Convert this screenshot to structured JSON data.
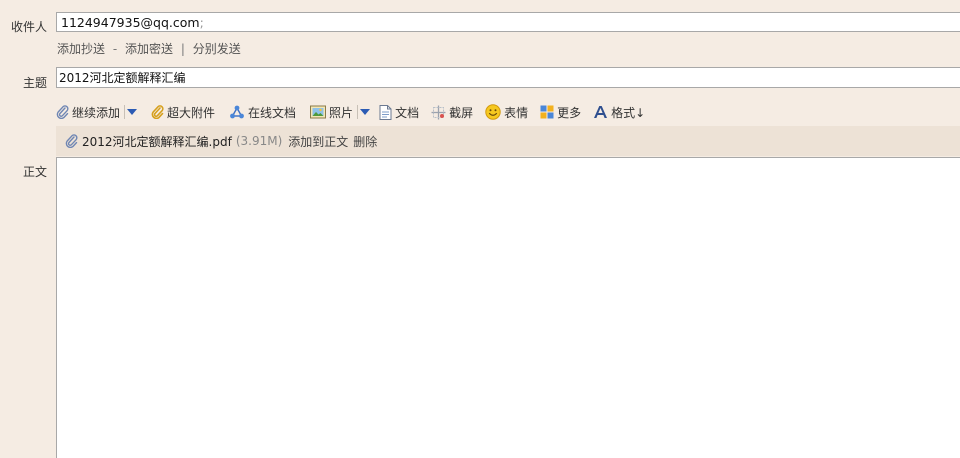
{
  "to": {
    "label": "收件人",
    "value": "1124947935@qq.com",
    "separator": ";"
  },
  "cc_links": {
    "add_cc": "添加抄送",
    "dash": "-",
    "add_bcc": "添加密送",
    "pipe": "|",
    "separate_send": "分别发送"
  },
  "subject": {
    "label": "主题",
    "value": "2012河北定额解释汇编"
  },
  "toolbar": {
    "continue_add": "继续添加",
    "large_attachment": "超大附件",
    "online_doc": "在线文档",
    "photo": "照片",
    "document": "文档",
    "screenshot": "截屏",
    "emoji": "表情",
    "more": "更多",
    "format": "格式↓"
  },
  "attachment": {
    "file_name": "2012河北定额解释汇编.pdf",
    "file_size": "(3.91M)",
    "add_to_body": "添加到正文",
    "delete": "删除"
  },
  "body": {
    "label": "正文",
    "value": ""
  },
  "colors": {
    "page_bg": "#f5ece3",
    "attachment_bar_bg": "#ede2d6",
    "field_border": "#a8a8a8"
  }
}
